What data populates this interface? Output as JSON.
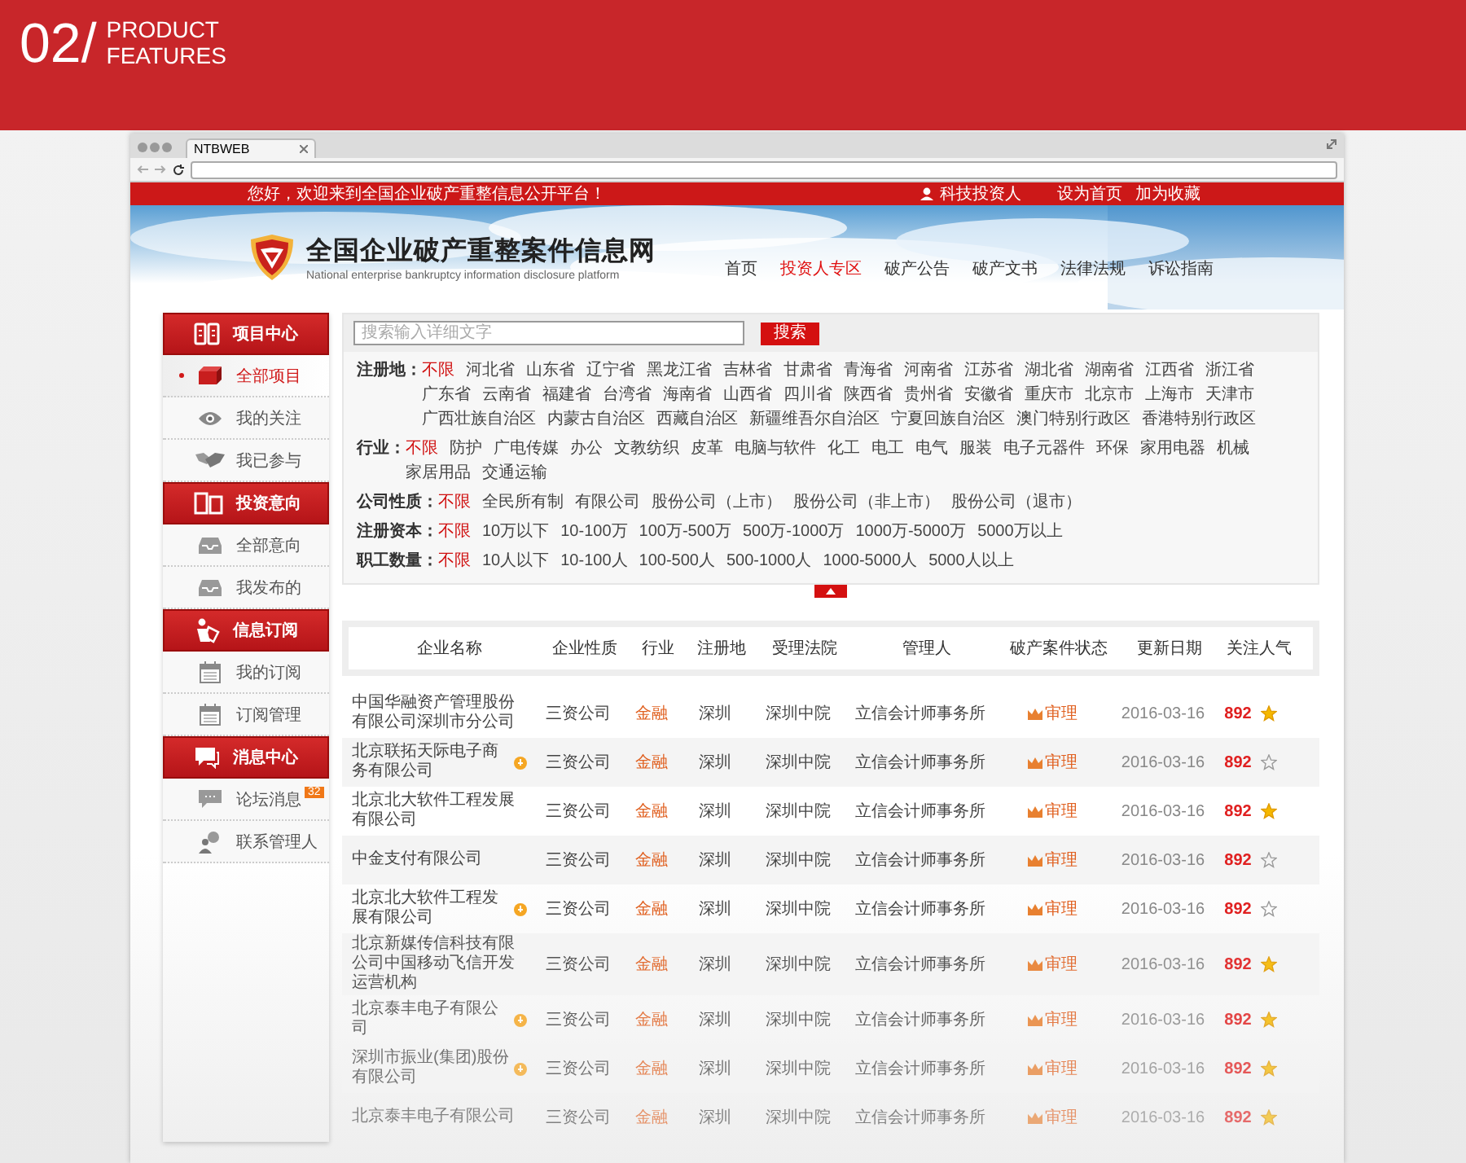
{
  "banner": {
    "number": "02/",
    "lines": [
      "PRODUCT",
      "FEATURES"
    ]
  },
  "browser": {
    "tab": "NTBWEB"
  },
  "topbar": {
    "greeting": "您好，欢迎来到全国企业破产重整信息公开平台！",
    "user": "科技投资人",
    "links": [
      "设为首页",
      "加为收藏"
    ]
  },
  "site": {
    "title": "全国企业破产重整案件信息网",
    "subtitle": "National enterprise bankruptcy  information disclosure platform",
    "nav": [
      {
        "label": "首页",
        "selected": false
      },
      {
        "label": "投资人专区",
        "selected": true
      },
      {
        "label": "破产公告",
        "selected": false
      },
      {
        "label": "破产文书",
        "selected": false
      },
      {
        "label": "法律法规",
        "selected": false
      },
      {
        "label": "诉讼指南",
        "selected": false
      }
    ]
  },
  "sidebar": {
    "groups": [
      {
        "title": "项目中心",
        "items": [
          {
            "label": "全部项目",
            "selected": true
          },
          {
            "label": "我的关注",
            "selected": false
          },
          {
            "label": "我已参与",
            "selected": false
          }
        ]
      },
      {
        "title": "投资意向",
        "items": [
          {
            "label": "全部意向",
            "selected": false
          },
          {
            "label": "我发布的",
            "selected": false
          }
        ]
      },
      {
        "title": "信息订阅",
        "items": [
          {
            "label": "我的订阅",
            "selected": false
          },
          {
            "label": "订阅管理",
            "selected": false
          }
        ]
      },
      {
        "title": "消息中心",
        "items": [
          {
            "label": "论坛消息",
            "selected": false,
            "badge": "32"
          },
          {
            "label": "联系管理人",
            "selected": false
          }
        ]
      }
    ]
  },
  "search": {
    "placeholder": "搜索输入详细文字",
    "button": "搜索"
  },
  "filters": [
    {
      "label": "注册地：",
      "options": [
        {
          "text": "不限",
          "selected": true
        },
        {
          "text": "河北省",
          "selected": false
        },
        {
          "text": "山东省",
          "selected": false
        },
        {
          "text": "辽宁省",
          "selected": false
        },
        {
          "text": "黑龙江省",
          "selected": false
        },
        {
          "text": "吉林省",
          "selected": false
        },
        {
          "text": "甘肃省",
          "selected": false
        },
        {
          "text": "青海省",
          "selected": false
        },
        {
          "text": "河南省",
          "selected": false
        },
        {
          "text": "江苏省",
          "selected": false
        },
        {
          "text": "湖北省",
          "selected": false
        },
        {
          "text": "湖南省",
          "selected": false
        },
        {
          "text": "江西省",
          "selected": false
        },
        {
          "text": "浙江省",
          "selected": false
        },
        {
          "text": "广东省",
          "selected": false
        },
        {
          "text": "云南省",
          "selected": false
        },
        {
          "text": "福建省",
          "selected": false
        },
        {
          "text": "台湾省",
          "selected": false
        },
        {
          "text": "海南省",
          "selected": false
        },
        {
          "text": "山西省",
          "selected": false
        },
        {
          "text": "四川省",
          "selected": false
        },
        {
          "text": "陕西省",
          "selected": false
        },
        {
          "text": "贵州省",
          "selected": false
        },
        {
          "text": "安徽省",
          "selected": false
        },
        {
          "text": "重庆市",
          "selected": false
        },
        {
          "text": "北京市",
          "selected": false
        },
        {
          "text": "上海市",
          "selected": false
        },
        {
          "text": "天津市",
          "selected": false
        },
        {
          "text": "广西壮族自治区",
          "selected": false
        },
        {
          "text": "内蒙古自治区",
          "selected": false
        },
        {
          "text": "西藏自治区",
          "selected": false
        },
        {
          "text": "新疆维吾尔自治区",
          "selected": false
        },
        {
          "text": "宁夏回族自治区",
          "selected": false
        },
        {
          "text": "澳门特别行政区",
          "selected": false
        },
        {
          "text": "香港特别行政区",
          "selected": false
        }
      ]
    },
    {
      "label": "行业：",
      "options": [
        {
          "text": "不限",
          "selected": true
        },
        {
          "text": "防护",
          "selected": false
        },
        {
          "text": "广电传媒",
          "selected": false
        },
        {
          "text": "办公",
          "selected": false
        },
        {
          "text": "文教纺织",
          "selected": false
        },
        {
          "text": "皮革",
          "selected": false
        },
        {
          "text": "电脑与软件",
          "selected": false
        },
        {
          "text": "化工",
          "selected": false
        },
        {
          "text": "电工",
          "selected": false
        },
        {
          "text": "电气",
          "selected": false
        },
        {
          "text": "服装",
          "selected": false
        },
        {
          "text": "电子元器件",
          "selected": false
        },
        {
          "text": "环保",
          "selected": false
        },
        {
          "text": "家用电器",
          "selected": false
        },
        {
          "text": "机械",
          "selected": false
        },
        {
          "text": "家居用品",
          "selected": false
        },
        {
          "text": "交通运输",
          "selected": false
        }
      ]
    },
    {
      "label": "公司性质：",
      "options": [
        {
          "text": "不限",
          "selected": true
        },
        {
          "text": "全民所有制",
          "selected": false
        },
        {
          "text": "有限公司",
          "selected": false
        },
        {
          "text": "股份公司（上市）",
          "selected": false
        },
        {
          "text": "股份公司（非上市）",
          "selected": false
        },
        {
          "text": "股份公司（退市）",
          "selected": false
        }
      ]
    },
    {
      "label": "注册资本：",
      "options": [
        {
          "text": "不限",
          "selected": true
        },
        {
          "text": "10万以下",
          "selected": false
        },
        {
          "text": "10-100万",
          "selected": false
        },
        {
          "text": "100万-500万",
          "selected": false
        },
        {
          "text": "500万-1000万",
          "selected": false
        },
        {
          "text": "1000万-5000万",
          "selected": false
        },
        {
          "text": "5000万以上",
          "selected": false
        }
      ]
    },
    {
      "label": "职工数量：",
      "options": [
        {
          "text": "不限",
          "selected": true
        },
        {
          "text": "10人以下",
          "selected": false
        },
        {
          "text": "10-100人",
          "selected": false
        },
        {
          "text": "100-500人",
          "selected": false
        },
        {
          "text": "500-1000人",
          "selected": false
        },
        {
          "text": "1000-5000人",
          "selected": false
        },
        {
          "text": "5000人以上",
          "selected": false
        }
      ]
    }
  ],
  "table": {
    "columns": [
      "企业名称",
      "企业性质",
      "行业",
      "注册地",
      "受理法院",
      "管理人",
      "破产案件状态",
      "更新日期",
      "关注人气"
    ],
    "rows": [
      {
        "name": "中国华融资产管理股份有限公司深圳市分公司",
        "badge": false,
        "type": "三资公司",
        "industry": "金融",
        "region": "深圳",
        "court": "深圳中院",
        "manager": "立信会计师事务所",
        "status": "审理",
        "date": "2016-03-16",
        "popularity": "892",
        "starred": true
      },
      {
        "name": "北京联拓天际电子商务有限公司",
        "badge": true,
        "type": "三资公司",
        "industry": "金融",
        "region": "深圳",
        "court": "深圳中院",
        "manager": "立信会计师事务所",
        "status": "审理",
        "date": "2016-03-16",
        "popularity": "892",
        "starred": false
      },
      {
        "name": "北京北大软件工程发展有限公司",
        "badge": false,
        "type": "三资公司",
        "industry": "金融",
        "region": "深圳",
        "court": "深圳中院",
        "manager": "立信会计师事务所",
        "status": "审理",
        "date": "2016-03-16",
        "popularity": "892",
        "starred": true
      },
      {
        "name": "中金支付有限公司",
        "badge": false,
        "type": "三资公司",
        "industry": "金融",
        "region": "深圳",
        "court": "深圳中院",
        "manager": "立信会计师事务所",
        "status": "审理",
        "date": "2016-03-16",
        "popularity": "892",
        "starred": false
      },
      {
        "name": "北京北大软件工程发展有限公司",
        "badge": true,
        "type": "三资公司",
        "industry": "金融",
        "region": "深圳",
        "court": "深圳中院",
        "manager": "立信会计师事务所",
        "status": "审理",
        "date": "2016-03-16",
        "popularity": "892",
        "starred": false
      },
      {
        "name": "北京新媒传信科技有限公司中国移动飞信开发运营机构",
        "badge": false,
        "type": "三资公司",
        "industry": "金融",
        "region": "深圳",
        "court": "深圳中院",
        "manager": "立信会计师事务所",
        "status": "审理",
        "date": "2016-03-16",
        "popularity": "892",
        "starred": true
      },
      {
        "name": "北京泰丰电子有限公司",
        "badge": true,
        "type": "三资公司",
        "industry": "金融",
        "region": "深圳",
        "court": "深圳中院",
        "manager": "立信会计师事务所",
        "status": "审理",
        "date": "2016-03-16",
        "popularity": "892",
        "starred": true
      },
      {
        "name": "深圳市振业(集团)股份有限公司",
        "badge": true,
        "type": "三资公司",
        "industry": "金融",
        "region": "深圳",
        "court": "深圳中院",
        "manager": "立信会计师事务所",
        "status": "审理",
        "date": "2016-03-16",
        "popularity": "892",
        "starred": true
      },
      {
        "name": "北京泰丰电子有限公司",
        "badge": false,
        "type": "三资公司",
        "industry": "金融",
        "region": "深圳",
        "court": "深圳中院",
        "manager": "立信会计师事务所",
        "status": "审理",
        "date": "2016-03-16",
        "popularity": "892",
        "starred": true
      }
    ]
  }
}
